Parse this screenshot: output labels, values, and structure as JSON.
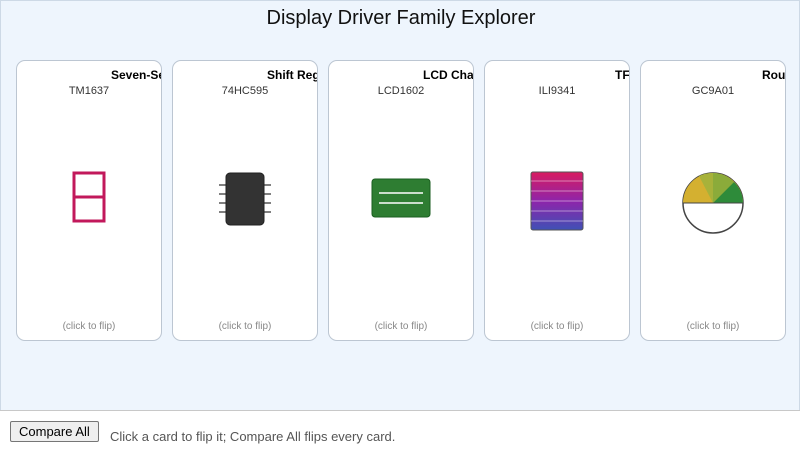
{
  "title": "Display Driver Family Explorer",
  "cards": [
    {
      "name": "Seven-Segment",
      "part": "TM1637",
      "hint": "(click to flip)",
      "icon": "seven-segment-icon",
      "accent": "#c2185b"
    },
    {
      "name": "Shift Register",
      "part": "74HC595",
      "hint": "(click to flip)",
      "icon": "ic-chip-icon",
      "accent": "#333333"
    },
    {
      "name": "LCD Character",
      "part": "LCD1602",
      "hint": "(click to flip)",
      "icon": "lcd-module-icon",
      "accent": "#2e7d32"
    },
    {
      "name": "TFT",
      "part": "ILI9341",
      "hint": "(click to flip)",
      "icon": "tft-panel-icon",
      "accent": "#8e24aa"
    },
    {
      "name": "Round",
      "part": "GC9A01",
      "hint": "(click to flip)",
      "icon": "round-display-icon",
      "accent": "#d4b030"
    }
  ],
  "controls": {
    "compare_label": "Compare All",
    "hint": "Click a card to flip it; Compare All flips every card."
  }
}
